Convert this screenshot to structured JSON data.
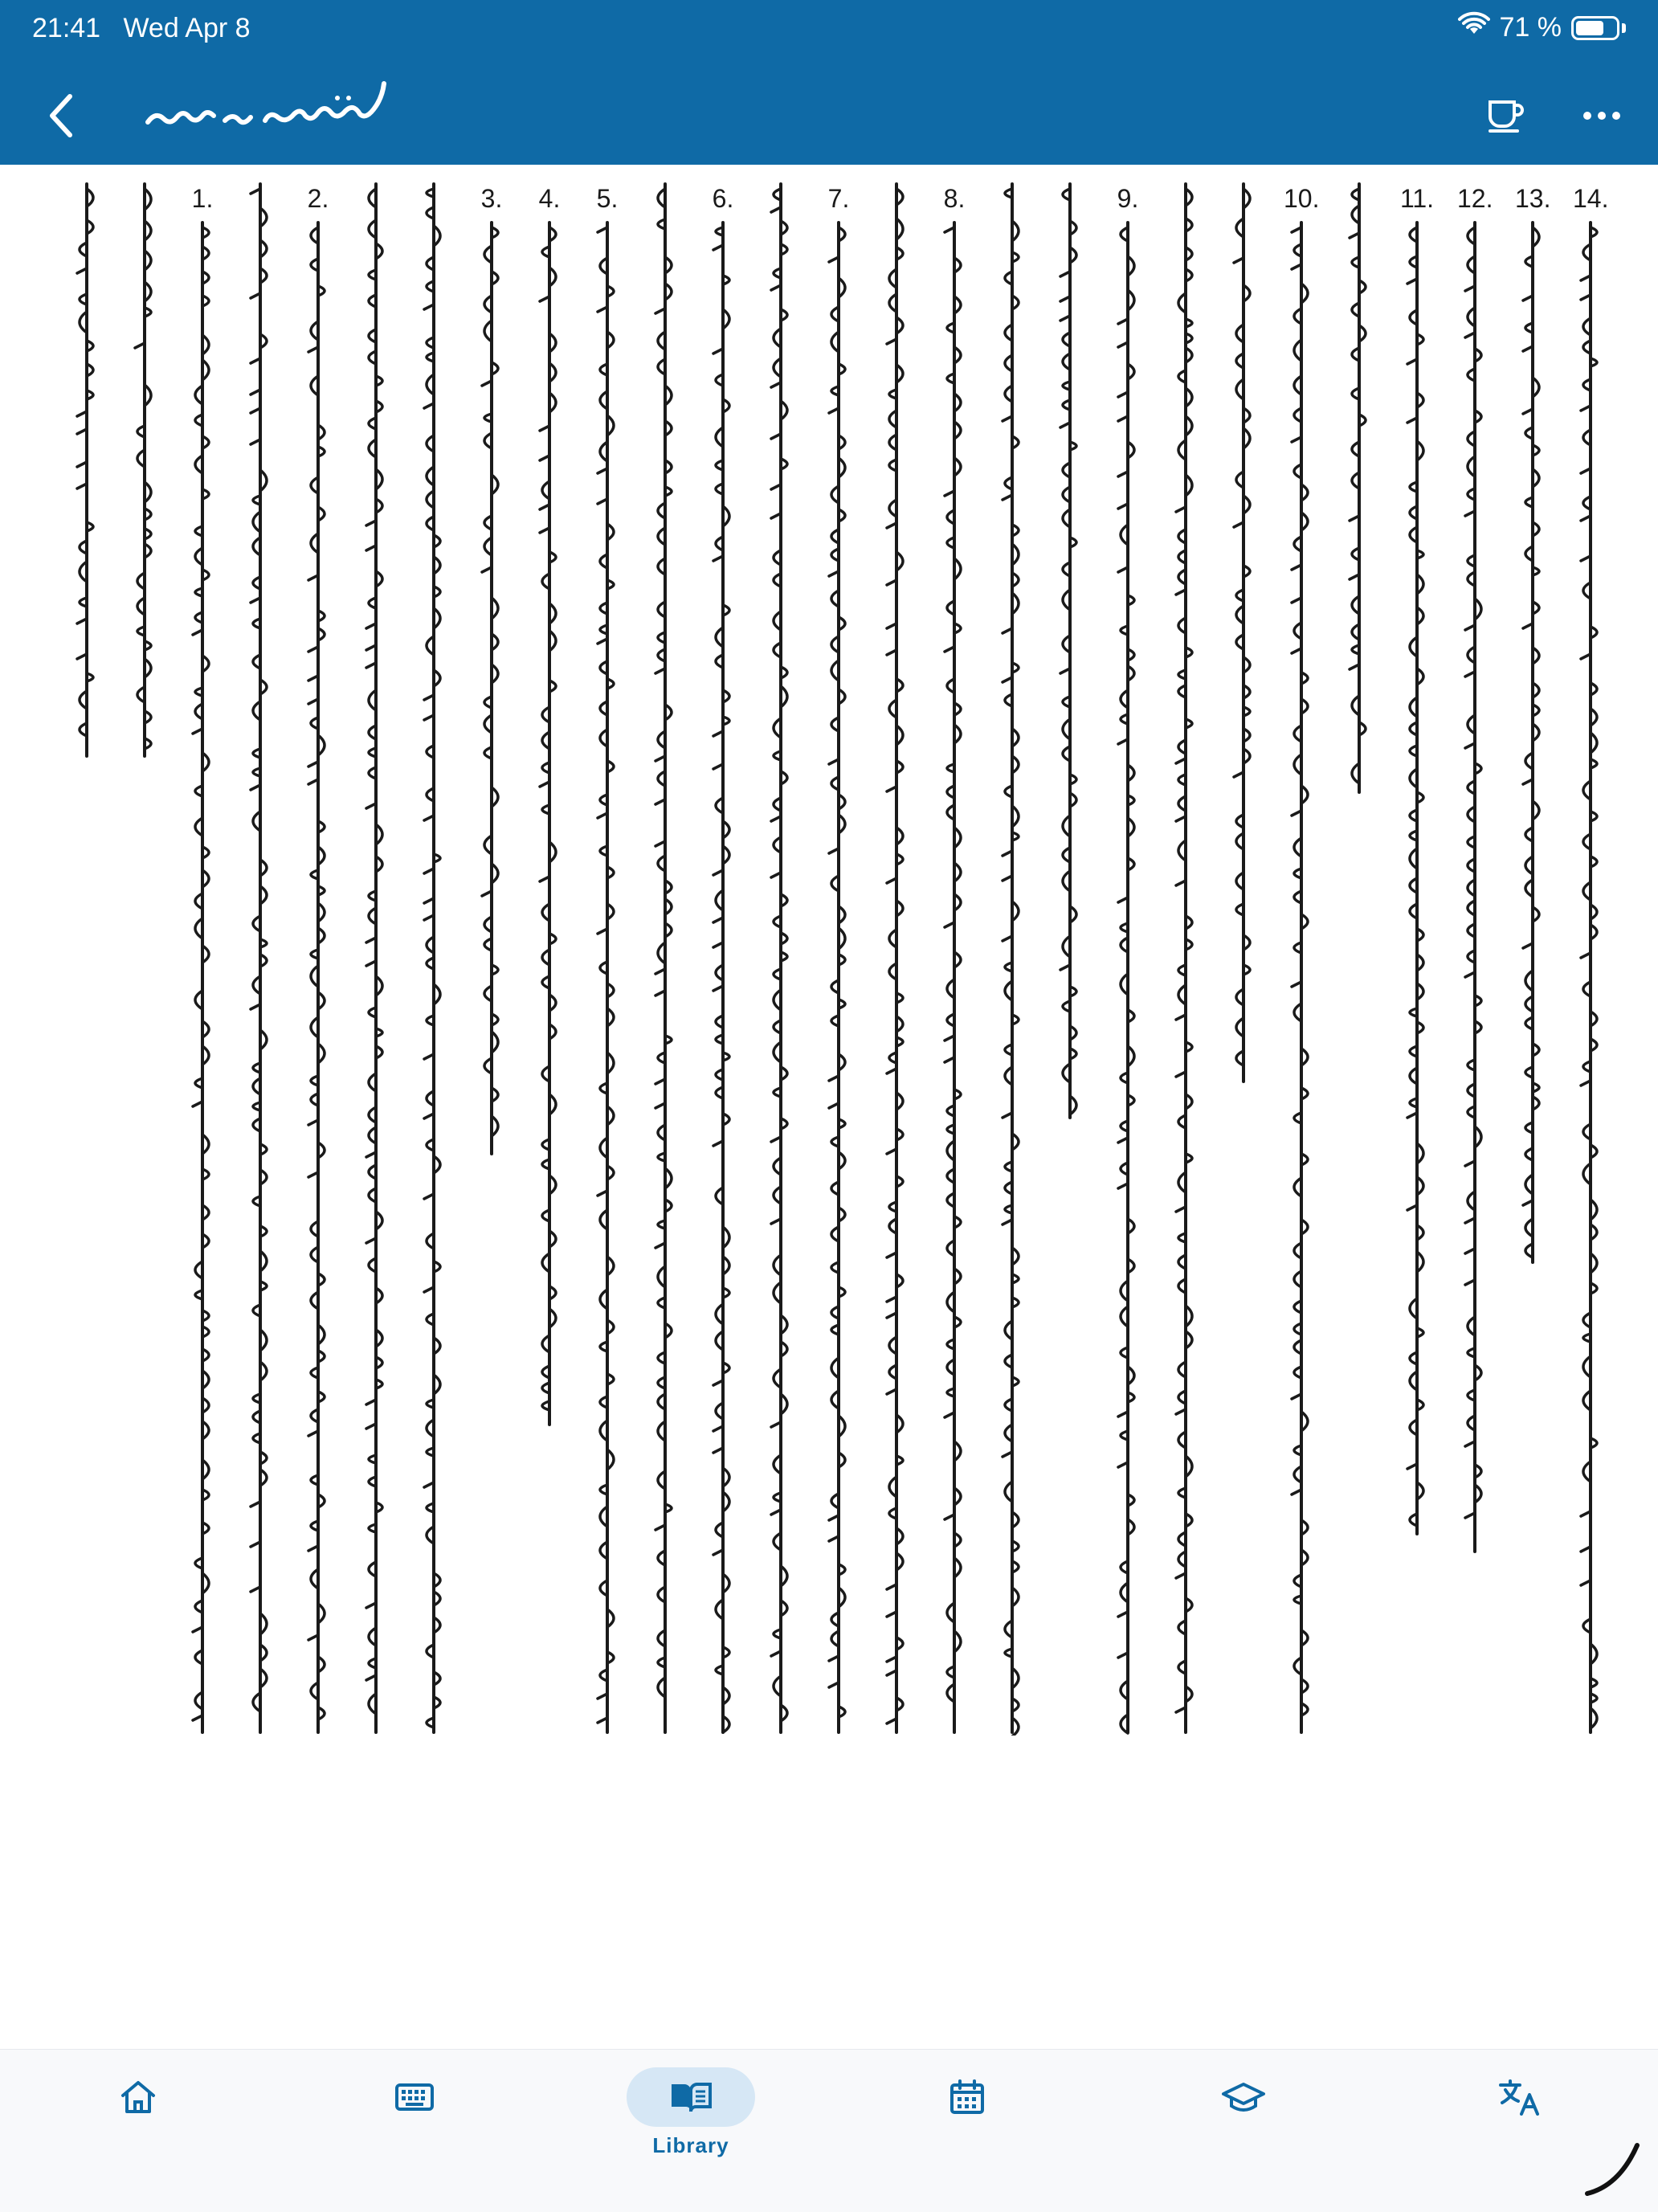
{
  "status_bar": {
    "time": "21:41",
    "date": "Wed Apr 8",
    "battery_percent": "71 %",
    "battery_level": 0.71,
    "icons": [
      "wifi-icon",
      "battery-icon"
    ]
  },
  "nav_bar": {
    "back_icon": "chevron-left-icon",
    "title_icon": "mongolian-script-title",
    "actions": [
      {
        "name": "coffee-cup-icon"
      },
      {
        "name": "more-horizontal-icon"
      }
    ]
  },
  "reader": {
    "columns": [
      {
        "num": "14.",
        "length": 0.86
      },
      {
        "num": "13.",
        "length": 0.6
      },
      {
        "num": "12.",
        "length": 0.76
      },
      {
        "num": "11.",
        "length": 0.75
      },
      {
        "num": "",
        "length": 0.34
      },
      {
        "num": "10.",
        "length": 0.86
      },
      {
        "num": "",
        "length": 0.5
      },
      {
        "num": "",
        "length": 0.86
      },
      {
        "num": "9.",
        "length": 0.86
      },
      {
        "num": "",
        "length": 0.52
      },
      {
        "num": "",
        "length": 0.86
      },
      {
        "num": "8.",
        "length": 0.86
      },
      {
        "num": "",
        "length": 0.86
      },
      {
        "num": "7.",
        "length": 0.86
      },
      {
        "num": "",
        "length": 0.86
      },
      {
        "num": "6.",
        "length": 0.86
      },
      {
        "num": "",
        "length": 0.86
      },
      {
        "num": "5.",
        "length": 0.86
      },
      {
        "num": "4.",
        "length": 0.69
      },
      {
        "num": "3.",
        "length": 0.54
      },
      {
        "num": "",
        "length": 0.86
      },
      {
        "num": "",
        "length": 0.86
      },
      {
        "num": "2.",
        "length": 0.86
      },
      {
        "num": "",
        "length": 0.86
      },
      {
        "num": "1.",
        "length": 0.86
      },
      {
        "num": "",
        "length": 0.32
      },
      {
        "num": "",
        "length": 0.32
      }
    ]
  },
  "bottom_nav": {
    "tabs": [
      {
        "icon": "home-icon",
        "label": "",
        "active": false
      },
      {
        "icon": "keyboard-icon",
        "label": "",
        "active": false
      },
      {
        "icon": "book-icon",
        "label": "Library",
        "active": true
      },
      {
        "icon": "calendar-icon",
        "label": "",
        "active": false
      },
      {
        "icon": "graduation-cap-icon",
        "label": "",
        "active": false
      },
      {
        "icon": "translate-icon",
        "label": "",
        "active": false
      }
    ]
  },
  "colors": {
    "header": "#0f6aa6",
    "accent": "#0f6aa6",
    "active_pill": "#d6e7f5",
    "text": "#1a1a1a"
  }
}
